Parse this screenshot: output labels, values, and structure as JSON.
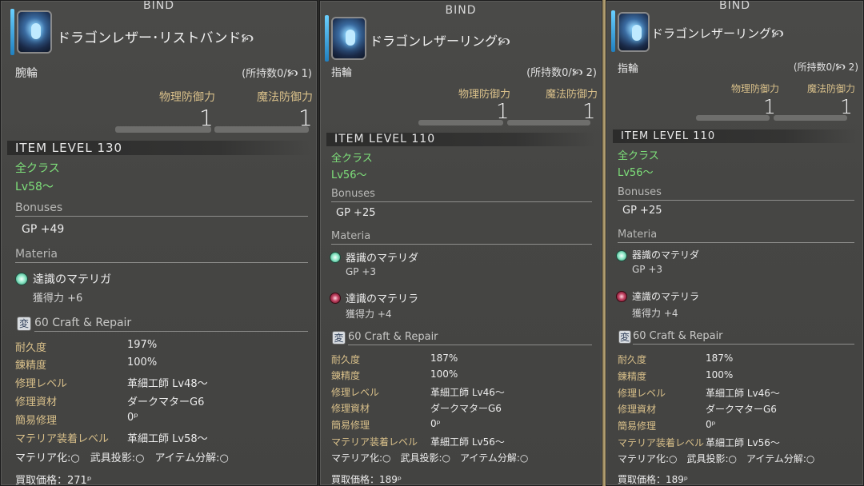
{
  "panels": [
    {
      "bind": "BIND",
      "name": "ドラゴンレザー･リストバンド",
      "hq_symbol": "🙥",
      "slot": "腕輪",
      "owned": "(所持数0/🙥 1)",
      "stats": {
        "phys_label": "物理防御力",
        "phys_value": "1",
        "mag_label": "魔法防御力",
        "mag_value": "1"
      },
      "item_level": "ITEM LEVEL 130",
      "classes": "全クラス",
      "level": "Lv58～",
      "bonuses_title": "Bonuses",
      "bonuses": [
        "GP +49"
      ],
      "materia_title": "Materia",
      "materia": [
        {
          "name": "達識のマテリガ",
          "effect": "獲得力 +6",
          "color": "green"
        }
      ],
      "craft_icon": "変",
      "craft_label": "60 Craft & Repair",
      "repair": [
        {
          "label": "耐久度",
          "value": "197%"
        },
        {
          "label": "錬精度",
          "value": "100%"
        },
        {
          "label": "修理レベル",
          "value": "革細工師 Lv48～"
        },
        {
          "label": "修理資材",
          "value": "ダークマターG6"
        },
        {
          "label": "簡易修理",
          "value": "0ᵖ"
        },
        {
          "label": "マテリア装着レベル",
          "value": "革細工師 Lv58～"
        }
      ],
      "flags": "マテリア化:○　武具投影:○　アイテム分解:○",
      "sell": "買取価格：271ᵖ"
    },
    {
      "bind": "BIND",
      "name": "ドラゴンレザーリング",
      "hq_symbol": "🙥",
      "slot": "指輪",
      "owned": "(所持数0/🙥 2)",
      "stats": {
        "phys_label": "物理防御力",
        "phys_value": "1",
        "mag_label": "魔法防御力",
        "mag_value": "1"
      },
      "item_level": "ITEM LEVEL 110",
      "classes": "全クラス",
      "level": "Lv56～",
      "bonuses_title": "Bonuses",
      "bonuses": [
        "GP +25"
      ],
      "materia_title": "Materia",
      "materia": [
        {
          "name": "器識のマテリダ",
          "effect": "GP +3",
          "color": "green"
        },
        {
          "name": "達識のマテリラ",
          "effect": "獲得力 +4",
          "color": "red"
        }
      ],
      "craft_icon": "変",
      "craft_label": "60 Craft & Repair",
      "repair": [
        {
          "label": "耐久度",
          "value": "187%"
        },
        {
          "label": "錬精度",
          "value": "100%"
        },
        {
          "label": "修理レベル",
          "value": "革細工師 Lv46～"
        },
        {
          "label": "修理資材",
          "value": "ダークマターG6"
        },
        {
          "label": "簡易修理",
          "value": "0ᵖ"
        },
        {
          "label": "マテリア装着レベル",
          "value": "革細工師 Lv56～"
        }
      ],
      "flags": "マテリア化:○　武具投影:○　アイテム分解:○",
      "sell": "買取価格：189ᵖ"
    },
    {
      "bind": "BIND",
      "name": "ドラゴンレザーリング",
      "hq_symbol": "🙥",
      "slot": "指輪",
      "owned": "(所持数0/🙥 2)",
      "stats": {
        "phys_label": "物理防御力",
        "phys_value": "1",
        "mag_label": "魔法防御力",
        "mag_value": "1"
      },
      "item_level": "ITEM LEVEL 110",
      "classes": "全クラス",
      "level": "Lv56～",
      "bonuses_title": "Bonuses",
      "bonuses": [
        "GP +25"
      ],
      "materia_title": "Materia",
      "materia": [
        {
          "name": "器識のマテリダ",
          "effect": "GP +3",
          "color": "green"
        },
        {
          "name": "達識のマテリラ",
          "effect": "獲得力 +4",
          "color": "red"
        }
      ],
      "craft_icon": "変",
      "craft_label": "60 Craft & Repair",
      "repair": [
        {
          "label": "耐久度",
          "value": "187%"
        },
        {
          "label": "錬精度",
          "value": "100%"
        },
        {
          "label": "修理レベル",
          "value": "革細工師 Lv46～"
        },
        {
          "label": "修理資材",
          "value": "ダークマターG6"
        },
        {
          "label": "簡易修理",
          "value": "0ᵖ"
        },
        {
          "label": "マテリア装着レベル",
          "value": "革細工師 Lv56～"
        }
      ],
      "flags": "マテリア化:○　武具投影:○　アイテム分解:○",
      "sell": "買取価格：189ᵖ"
    }
  ]
}
